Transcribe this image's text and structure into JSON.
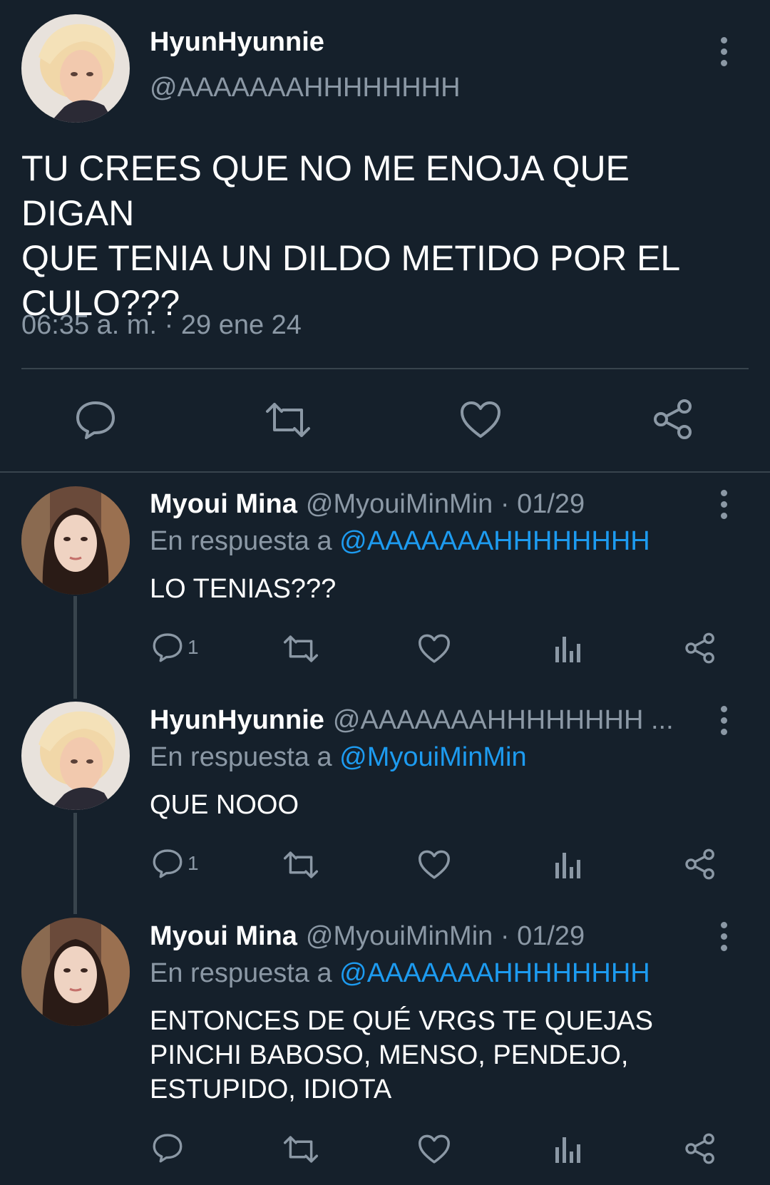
{
  "main_tweet": {
    "name": "HyunHyunnie",
    "handle": "@AAAAAAAHHHHHHHH",
    "text": "TU CREES QUE NO ME ENOJA QUE DIGAN\nQUE TENIA UN DILDO METIDO POR EL\nCULO???",
    "timestamp": "06:35 a. m. · 29 ene 24",
    "actions": [
      "reply-icon",
      "retweet-icon",
      "like-icon",
      "share-icon"
    ]
  },
  "replies": [
    {
      "name": "Myoui Mina",
      "handle": "@MyouiMinMin",
      "date": "· 01/29",
      "reply_prefix": "En respuesta a",
      "reply_to": "@AAAAAAAHHHHHHHH",
      "text": "LO TENIAS???",
      "reply_count": "1"
    },
    {
      "name": "HyunHyunnie",
      "handle": "@AAAAAAAHHHHHHHH ...",
      "date": "",
      "reply_prefix": "En respuesta a",
      "reply_to": "@MyouiMinMin",
      "text": "QUE NOOO",
      "reply_count": "1"
    },
    {
      "name": "Myoui Mina",
      "handle": "@MyouiMinMin",
      "date": "· 01/29",
      "reply_prefix": "En respuesta a",
      "reply_to": "@AAAAAAAHHHHHHHH",
      "text": "ENTONCES DE QUÉ VRGS TE QUEJAS\nPINCHI BABOSO, MENSO, PENDEJO,\nESTUPIDO, IDIOTA",
      "reply_count": ""
    }
  ],
  "colors": {
    "background": "#15202b",
    "text_primary": "#ffffff",
    "text_secondary": "#8b98a5",
    "accent_link": "#1d9bf0",
    "divider": "#38444d"
  }
}
